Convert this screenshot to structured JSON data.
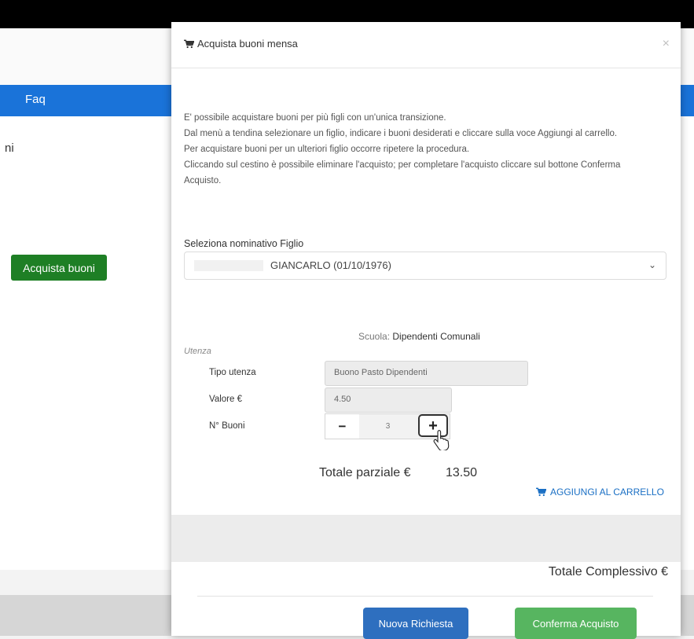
{
  "background": {
    "nav_faq": "Faq",
    "partial_text": "ni",
    "buy_button": "Acquista buoni"
  },
  "modal": {
    "title": "Acquista buoni mensa",
    "close": "×",
    "intro": [
      "E' possibile acquistare buoni per più figli con un'unica transizione.",
      "Dal menù a tendina selezionare un figlio, indicare i buoni desiderati e cliccare sulla voce Aggiungi al carrello.",
      "Per acquistare buoni per un ulteriori figlio occorre ripetere la procedura.",
      "Cliccando sul cestino è possibile eliminare l'acquisto; per completare l'acquisto cliccare sul bottone Conferma Acquisto."
    ],
    "select_label": "Seleziona nominativo Figlio",
    "select_value": "GIANCARLO (01/10/1976)",
    "school_label": "Scuola:",
    "school_value": "Dipendenti Comunali",
    "utenza_label": "Utenza",
    "tipo_label": "Tipo utenza",
    "tipo_value": "Buono Pasto Dipendenti",
    "valore_label": "Valore €",
    "valore_value": "4.50",
    "nbuoni_label": "N° Buoni",
    "nbuoni_value": "3",
    "minus": "−",
    "plus": "+",
    "subtotal_label": "Totale parziale €",
    "subtotal_value": "13.50",
    "add_to_cart": "AGGIUNGI AL CARRELLO",
    "grand_total_label": "Totale Complessivo €",
    "new_request": "Nuova Richiesta",
    "confirm": "Conferma Acquisto"
  },
  "icons": {
    "cart": "cart-icon",
    "select_arrow": "chevron-down-icon",
    "pointer": "hand-pointer-icon"
  },
  "colors": {
    "nav": "#1a73d9",
    "buy_button": "#1e7f25",
    "new_request": "#2e6fbf",
    "confirm": "#57b560",
    "link": "#1a6fc4"
  }
}
